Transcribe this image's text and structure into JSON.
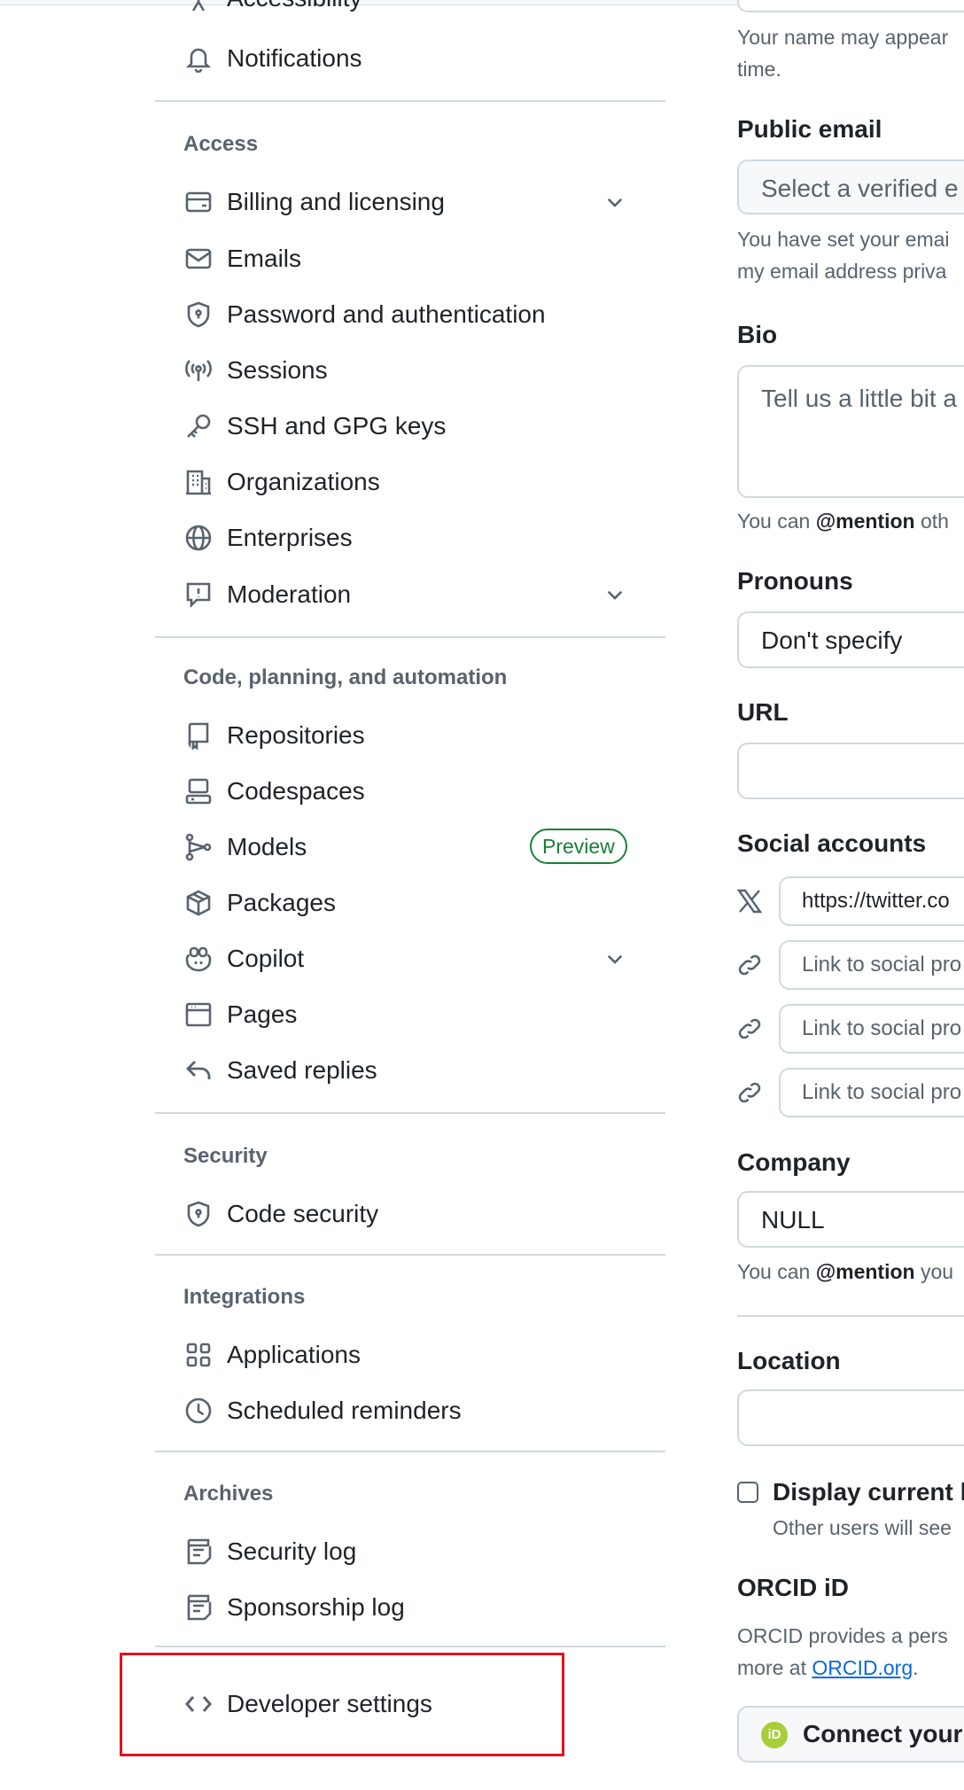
{
  "sidebar": {
    "partial_item": {
      "label": "Accessibility"
    },
    "notifications": {
      "label": "Notifications"
    },
    "sections": {
      "access": "Access",
      "code": "Code, planning, and automation",
      "security": "Security",
      "integrations": "Integrations",
      "archives": "Archives"
    },
    "access_items": [
      {
        "label": "Billing and licensing",
        "icon": "credit-card-icon",
        "expandable": true
      },
      {
        "label": "Emails",
        "icon": "mail-icon"
      },
      {
        "label": "Password and authentication",
        "icon": "shield-lock-icon"
      },
      {
        "label": "Sessions",
        "icon": "broadcast-icon"
      },
      {
        "label": "SSH and GPG keys",
        "icon": "key-icon"
      },
      {
        "label": "Organizations",
        "icon": "organization-icon"
      },
      {
        "label": "Enterprises",
        "icon": "globe-icon"
      },
      {
        "label": "Moderation",
        "icon": "report-icon",
        "expandable": true
      }
    ],
    "code_items": [
      {
        "label": "Repositories",
        "icon": "repo-icon"
      },
      {
        "label": "Codespaces",
        "icon": "codespaces-icon"
      },
      {
        "label": "Models",
        "icon": "models-icon",
        "badge": "Preview"
      },
      {
        "label": "Packages",
        "icon": "package-icon"
      },
      {
        "label": "Copilot",
        "icon": "copilot-icon",
        "expandable": true
      },
      {
        "label": "Pages",
        "icon": "browser-icon"
      },
      {
        "label": "Saved replies",
        "icon": "reply-icon"
      }
    ],
    "security_items": [
      {
        "label": "Code security",
        "icon": "shield-lock-icon"
      }
    ],
    "integration_items": [
      {
        "label": "Applications",
        "icon": "apps-icon"
      },
      {
        "label": "Scheduled reminders",
        "icon": "clock-icon"
      }
    ],
    "archive_items": [
      {
        "label": "Security log",
        "icon": "log-icon"
      },
      {
        "label": "Sponsorship log",
        "icon": "log-icon"
      }
    ],
    "developer_settings": {
      "label": "Developer settings",
      "icon": "code-icon"
    }
  },
  "profile_form": {
    "name_note_line1": "Your name may appear",
    "name_note_line2": "time.",
    "public_email": {
      "label": "Public email",
      "placeholder": "Select a verified e",
      "note_line1": "You have set your emai",
      "note_line2": "my email address priva"
    },
    "bio": {
      "label": "Bio",
      "placeholder": "Tell us a little bit a",
      "note_prefix": "You can ",
      "note_mention": "@mention",
      "note_suffix": " oth"
    },
    "pronouns": {
      "label": "Pronouns",
      "value": "Don't specify"
    },
    "url": {
      "label": "URL",
      "value": ""
    },
    "social": {
      "label": "Social accounts",
      "x_value": "https://twitter.co",
      "link_placeholder": "Link to social pro"
    },
    "company": {
      "label": "Company",
      "value": "NULL",
      "note_prefix": "You can ",
      "note_mention": "@mention",
      "note_suffix": " you"
    },
    "location": {
      "label": "Location",
      "value": ""
    },
    "display_time": {
      "label": "Display current l",
      "note": "Other users will see"
    },
    "orcid": {
      "label": "ORCID iD",
      "note_line1": "ORCID provides a pers",
      "note_line2_prefix": "more at ",
      "link_text": "ORCID.org",
      "note_line2_suffix": ".",
      "button_label": "Connect your",
      "button_icon_text": "iD"
    }
  },
  "colors": {
    "accent_link": "#0969da",
    "badge_green": "#1a7f37",
    "highlight_red": "#e3131b",
    "orcid_green": "#a6ce39"
  }
}
